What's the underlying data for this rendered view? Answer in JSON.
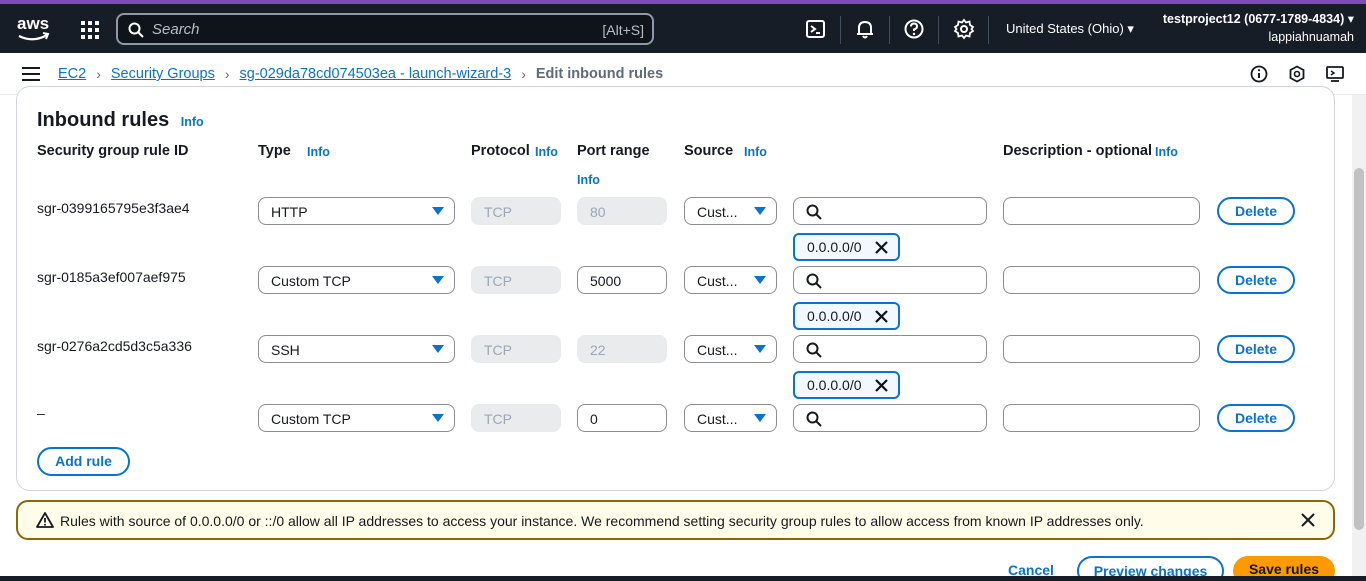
{
  "topnav": {
    "logo_text": "aws",
    "search_placeholder": "Search",
    "search_shortcut": "[Alt+S]",
    "region": "United States (Ohio) ▾",
    "account_name": "testproject12 (0677-1789-4834) ▾",
    "account_user": "lappiahnuamah",
    "icons": [
      "cloudshell-icon",
      "bell-icon",
      "help-icon",
      "gear-icon"
    ]
  },
  "breadcrumb": {
    "items": [
      "EC2",
      "Security Groups",
      "sg-029da78cd074503ea - launch-wizard-3"
    ],
    "current": "Edit inbound rules",
    "separator": "›"
  },
  "panel": {
    "title": "Inbound rules",
    "title_info": "Info",
    "headers": {
      "rule_id": "Security group rule ID",
      "type": "Type",
      "type_info": "Info",
      "protocol": "Protocol",
      "protocol_info": "Info",
      "port_range": "Port range",
      "port_info": "Info",
      "source": "Source",
      "source_info": "Info",
      "description": "Description - optional",
      "description_info": "Info"
    },
    "rules": [
      {
        "id": "sgr-0399165795e3f3ae4",
        "type": "HTTP",
        "protocol": "TCP",
        "port": "80",
        "port_disabled": true,
        "source": "Cust...",
        "token": "0.0.0.0/0",
        "delete": "Delete"
      },
      {
        "id": "sgr-0185a3ef007aef975",
        "type": "Custom TCP",
        "protocol": "TCP",
        "port": "5000",
        "port_disabled": false,
        "source": "Cust...",
        "token": "0.0.0.0/0",
        "delete": "Delete"
      },
      {
        "id": "sgr-0276a2cd5d3c5a336",
        "type": "SSH",
        "protocol": "TCP",
        "port": "22",
        "port_disabled": true,
        "source": "Cust...",
        "token": "0.0.0.0/0",
        "delete": "Delete"
      },
      {
        "id": "–",
        "type": "Custom TCP",
        "protocol": "TCP",
        "port": "0",
        "port_disabled": false,
        "source": "Cust...",
        "token": null,
        "delete": "Delete"
      }
    ],
    "add_rule": "Add rule"
  },
  "warning": {
    "text": "Rules with source of 0.0.0.0/0 or ::/0 allow all IP addresses to access your instance. We recommend setting security group rules to allow access from known IP addresses only."
  },
  "footer": {
    "cancel": "Cancel",
    "preview": "Preview changes",
    "save": "Save rules"
  },
  "colors": {
    "nav_bg": "#161d26",
    "link": "#0972d3",
    "primary_button": "#ff9900",
    "warning_border": "#8d6605"
  }
}
